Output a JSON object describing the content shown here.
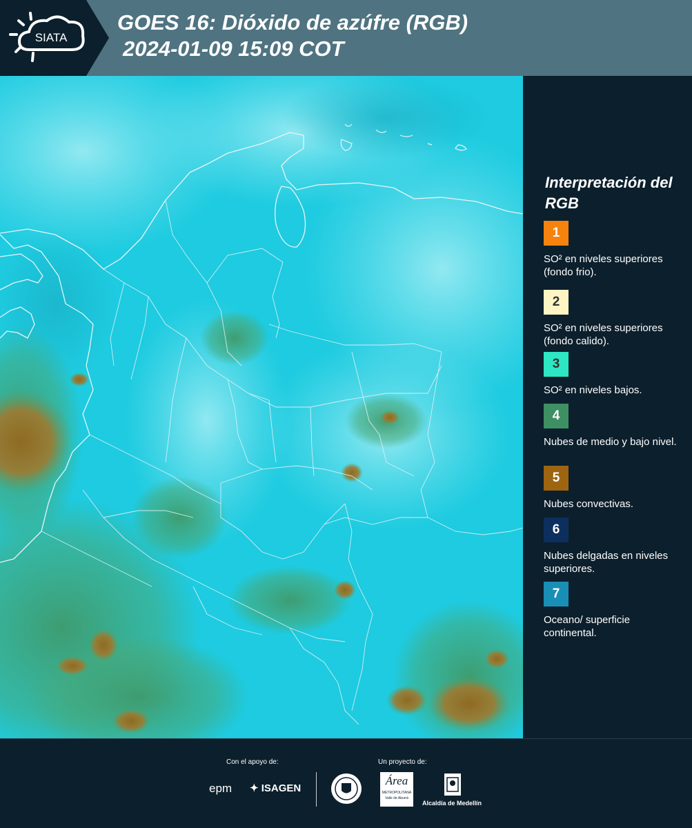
{
  "header": {
    "logo_text": "SIATA",
    "title_line1": "GOES 16: Dióxido de azúfre (RGB)",
    "title_line2": "2024-01-09 15:09 COT"
  },
  "legend": {
    "title": "Interpretación del RGB",
    "items": [
      {
        "num": "1",
        "text": "SO² en niveles superiores (fondo frio).",
        "color": "#f7830f"
      },
      {
        "num": "2",
        "text": "SO² en niveles superiores (fondo calido).",
        "color": "#fdf5c4"
      },
      {
        "num": "3",
        "text": "SO² en niveles bajos.",
        "color": "#2de6c4"
      },
      {
        "num": "4",
        "text": "Nubes de medio y bajo nivel.",
        "color": "#3e8f63"
      },
      {
        "num": "5",
        "text": "Nubes convectivas.",
        "color": "#9e6511"
      },
      {
        "num": "6",
        "text": "Nubes delgadas en niveles superiores.",
        "color": "#0d2f5e"
      },
      {
        "num": "7",
        "text": "Oceano/ superficie continental.",
        "color": "#1a8fb5"
      }
    ]
  },
  "footer": {
    "support_label": "Con el apoyo de:",
    "project_label": "Un proyecto de:",
    "brand_epm": "epm",
    "brand_isagen": "ISAGEN",
    "area_logo_text": "Área",
    "area_sub": "METROPOLITANA",
    "area_sub2": "Valle de Aburrá",
    "alcaldia_text": "Alcaldía de Medellín"
  },
  "colors": {
    "header_bg": "#4f7380",
    "panel_bg": "#0c1f2c",
    "map_base": "#1ecbe0",
    "map_light": "#7be4ef",
    "map_green": "#3f9a6b",
    "map_brown": "#9e7a30",
    "border_line": "#e8f4f8"
  }
}
